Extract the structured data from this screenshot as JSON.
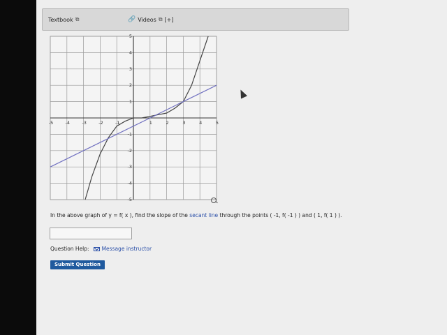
{
  "toolbar": {
    "textbook_label": "Textbook",
    "videos_label": "Videos",
    "videos_expand": "[+]"
  },
  "question": {
    "part1": "In the above graph of y = f( x ), find the slope of the ",
    "link": "secant line",
    "part2": " through the points ( -1, f( -1 ) ) and ( 1, f( 1 ) )."
  },
  "answer": {
    "value": ""
  },
  "help": {
    "label": "Question Help:",
    "message_link": "Message instructor"
  },
  "submit": {
    "label": "Submit Question"
  },
  "chart_data": {
    "type": "line",
    "xlim": [
      -5,
      5
    ],
    "ylim": [
      -5,
      5
    ],
    "xticks": [
      "-5",
      "-4",
      "-3",
      "-2",
      "-1",
      "1",
      "2",
      "3",
      "4",
      "5"
    ],
    "yticks": [
      "-5",
      "-4",
      "-3",
      "-2",
      "-1",
      "1",
      "2",
      "3",
      "4",
      "5"
    ],
    "grid": true,
    "series": [
      {
        "values": [
          [
            -2.9,
            -5
          ],
          [
            -2.5,
            -3.6
          ],
          [
            -2,
            -2.2
          ],
          [
            -1.5,
            -1.2
          ],
          [
            -1,
            -0.5
          ],
          [
            -0.5,
            -0.2
          ],
          [
            0,
            0
          ],
          [
            0.5,
            0
          ],
          [
            1,
            0.1
          ],
          [
            1.5,
            0.2
          ],
          [
            2,
            0.3
          ],
          [
            2.5,
            0.6
          ],
          [
            3,
            1
          ],
          [
            3.5,
            2
          ],
          [
            4,
            3.5
          ],
          [
            4.5,
            5
          ]
        ],
        "color": "#444444"
      },
      {
        "values": [
          [
            -5,
            -3
          ],
          [
            5,
            2
          ]
        ],
        "color": "#7070c0"
      }
    ]
  }
}
